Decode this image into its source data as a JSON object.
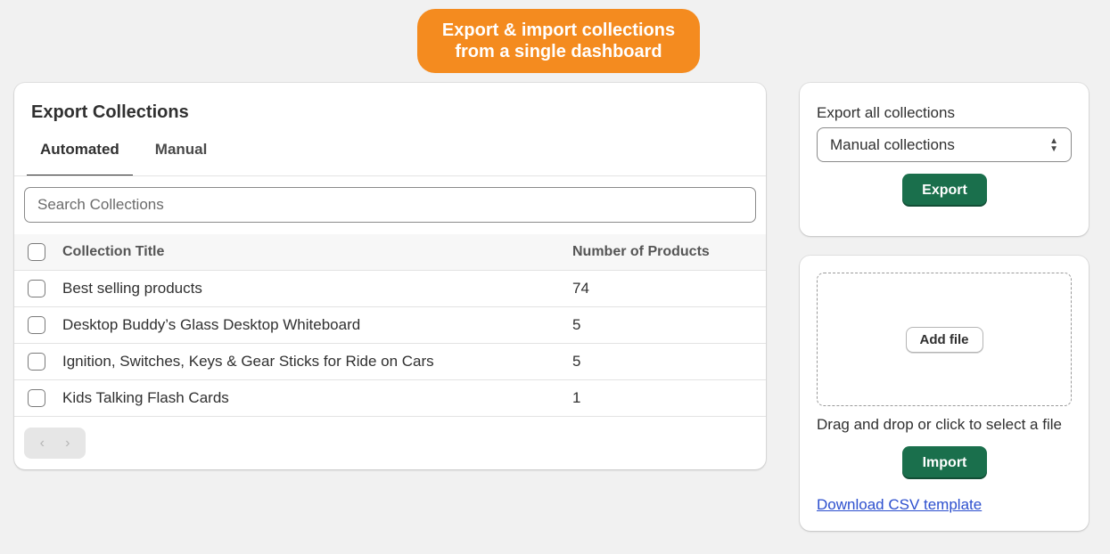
{
  "banner": {
    "line1": "Export & import collections",
    "line2": "from a single dashboard"
  },
  "export_card": {
    "title": "Export Collections",
    "tabs": [
      {
        "label": "Automated",
        "active": true
      },
      {
        "label": "Manual",
        "active": false
      }
    ],
    "search": {
      "placeholder": "Search Collections",
      "value": ""
    },
    "table": {
      "headers": [
        "Collection Title",
        "Number of Products"
      ],
      "rows": [
        {
          "title": "Best selling products",
          "count": "74"
        },
        {
          "title": "Desktop Buddy’s Glass Desktop Whiteboard",
          "count": "5"
        },
        {
          "title": "Ignition, Switches, Keys & Gear Sticks for Ride on Cars",
          "count": "5"
        },
        {
          "title": "Kids Talking Flash Cards",
          "count": "1"
        }
      ]
    },
    "pager": {
      "prev": "‹",
      "next": "›"
    }
  },
  "export_all": {
    "label": "Export all collections",
    "selected": "Manual collections",
    "button": "Export"
  },
  "import": {
    "add_file": "Add file",
    "hint": "Drag and drop or click to select a file",
    "button": "Import",
    "template_link": "Download CSV template"
  },
  "colors": {
    "accent": "#1a6f4c",
    "banner": "#f48b1f",
    "link": "#2c4fce"
  }
}
